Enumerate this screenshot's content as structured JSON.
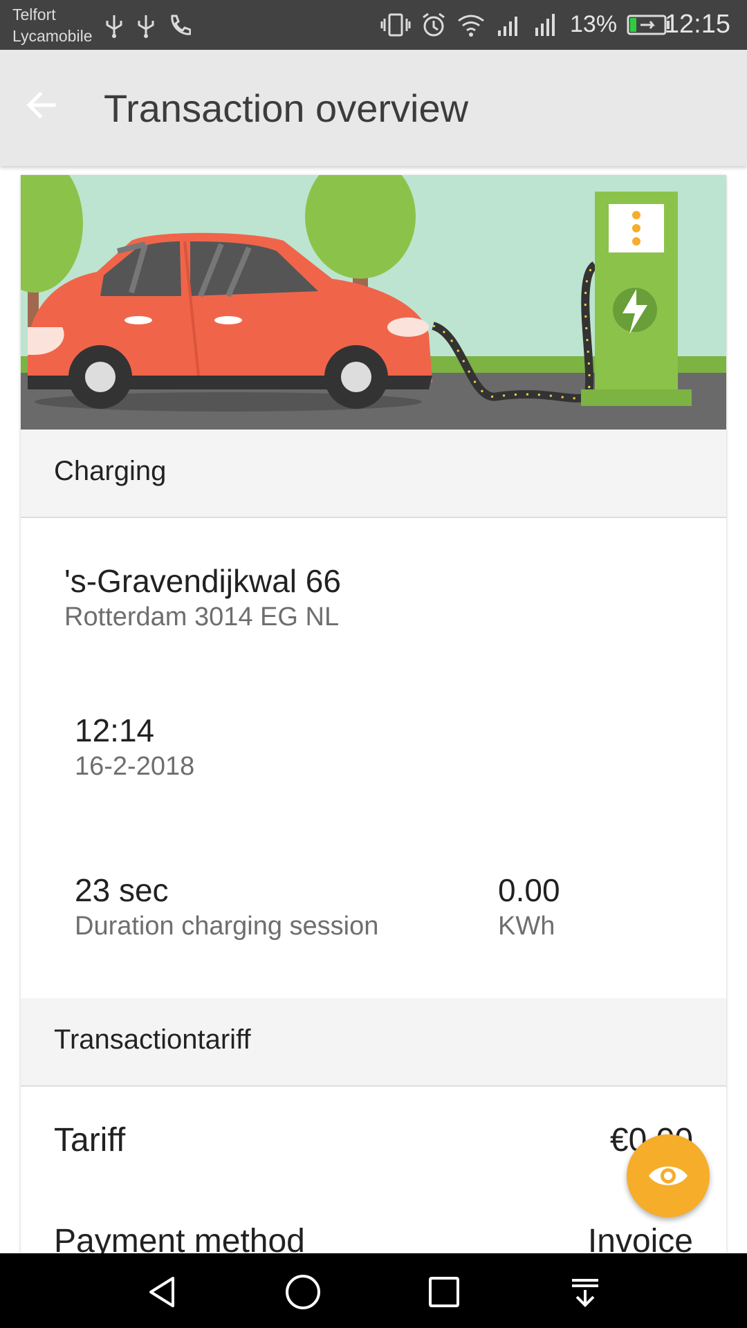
{
  "status_bar": {
    "carrier_1": "Telfort",
    "carrier_2": "Lycamobile",
    "battery": "13%",
    "time": "12:15",
    "icons_left": [
      "usb-icon",
      "usb-icon",
      "phone-icon"
    ],
    "icons_right": [
      "vibrate-icon",
      "alarm-icon",
      "wifi-icon",
      "signal-icon",
      "signal-roaming-icon",
      "battery-charging-icon"
    ]
  },
  "app_bar": {
    "title": "Transaction overview",
    "back_icon": "arrow-back-icon"
  },
  "hero_image": "car-charging-illustration",
  "charging": {
    "header": "Charging",
    "address_line1": "'s-Gravendijkwal 66",
    "address_line2": "Rotterdam 3014 EG NL",
    "time": "12:14",
    "date": "16-2-2018",
    "duration_value": "23 sec",
    "duration_label": "Duration charging session",
    "energy_value": "0.00",
    "energy_unit": "KWh"
  },
  "tariff": {
    "header": "Transactiontariff",
    "tariff_label": "Tariff",
    "tariff_value": "€0.00",
    "payment_label": "Payment method",
    "payment_value": "Invoice"
  },
  "fab": {
    "icon": "eye-icon"
  },
  "nav_bar": {
    "buttons": [
      "back-triangle-icon",
      "home-circle-icon",
      "recents-square-icon",
      "notifications-pulldown-icon"
    ]
  },
  "colors": {
    "accent": "#f5ad2a",
    "status_bar": "#424242",
    "app_bar": "#e8e8e8",
    "car": "#f0654a",
    "charger": "#8bc34a"
  }
}
